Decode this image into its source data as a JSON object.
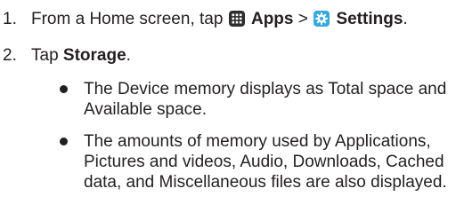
{
  "steps": [
    {
      "number": "1.",
      "parts": {
        "intro": "From a Home screen, tap",
        "apps_icon": "apps-grid-icon",
        "apps_label": "Apps",
        "separator": ">",
        "settings_icon": "settings-gear-icon",
        "settings_label": "Settings",
        "end": "."
      }
    },
    {
      "number": "2.",
      "parts": {
        "intro": "Tap",
        "storage_label": "Storage",
        "end": "."
      }
    }
  ],
  "bullets": [
    "The Device memory displays as Total space and Available space.",
    "The amounts of memory used by Applications, Pictures and videos, Audio, Downloads, Cached data, and Miscellaneous files are also displayed."
  ],
  "colors": {
    "text": "#231f20",
    "apps_icon_bg": "#2d2d2d",
    "settings_icon_bg": "#35a8df"
  }
}
